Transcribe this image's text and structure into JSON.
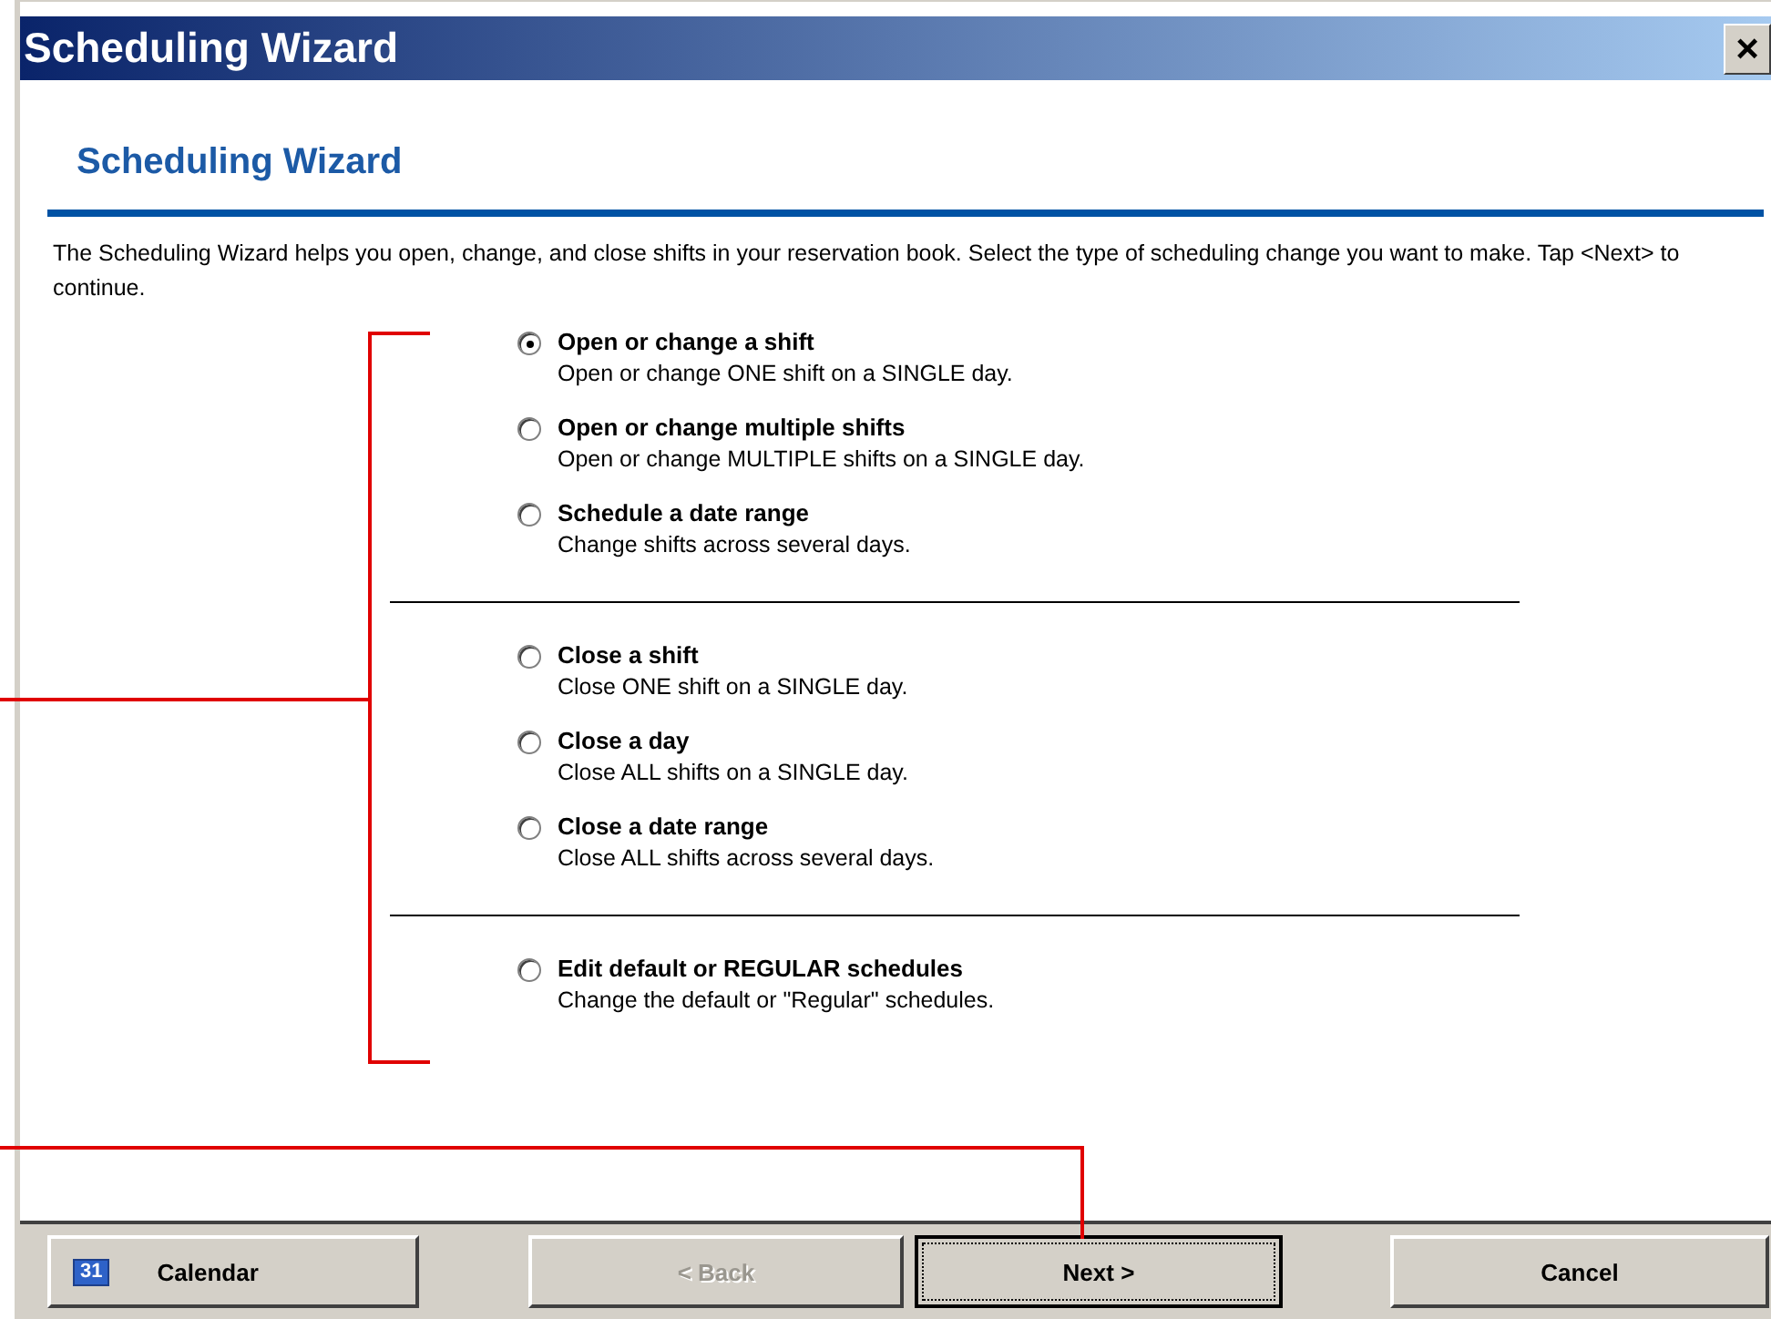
{
  "window": {
    "title": "Scheduling Wizard",
    "close": "×"
  },
  "heading": "Scheduling Wizard",
  "description": "The Scheduling Wizard helps you open, change, and close shifts in your reservation book.  Select the type of scheduling change you want to make.  Tap <Next> to continue.",
  "option_groups": [
    {
      "options": [
        {
          "title": "Open or change a shift",
          "description": "Open or change ONE shift on a SINGLE day.",
          "selected": true
        },
        {
          "title": "Open or change multiple shifts",
          "description": "Open or change MULTIPLE shifts on a SINGLE day.",
          "selected": false
        },
        {
          "title": "Schedule a date range",
          "description": "Change shifts across several days.",
          "selected": false
        }
      ]
    },
    {
      "options": [
        {
          "title": "Close a shift",
          "description": "Close ONE shift on a SINGLE day.",
          "selected": false
        },
        {
          "title": "Close a day",
          "description": "Close ALL shifts on a SINGLE day.",
          "selected": false
        },
        {
          "title": "Close a date range",
          "description": "Close ALL shifts across several days.",
          "selected": false
        }
      ]
    },
    {
      "options": [
        {
          "title": "Edit default or REGULAR schedules",
          "description": "Change the default or \"Regular\" schedules.",
          "selected": false
        }
      ]
    }
  ],
  "buttons": [
    {
      "label": "Calendar",
      "icon_text": "31",
      "disabled": false,
      "focused": false
    },
    {
      "label": "< Back",
      "disabled": true,
      "focused": false
    },
    {
      "label": "Next >",
      "disabled": false,
      "focused": true
    },
    {
      "label": "Cancel",
      "disabled": false,
      "focused": false
    }
  ]
}
